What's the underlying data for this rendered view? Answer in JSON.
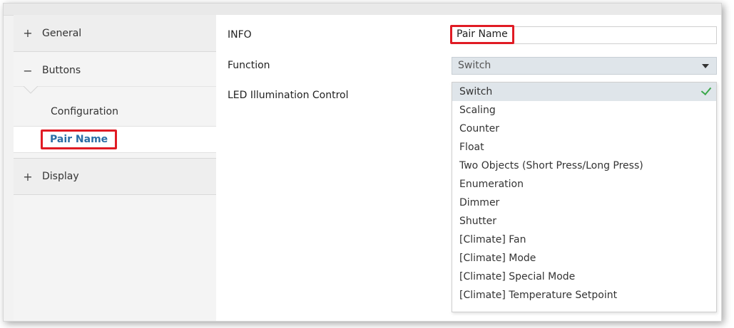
{
  "sidebar": {
    "general": {
      "sign": "+",
      "label": "General"
    },
    "buttons": {
      "sign": "−",
      "label": "Buttons"
    },
    "configuration": {
      "label": "Configuration"
    },
    "pair_name": {
      "label": "Pair Name"
    },
    "display": {
      "sign": "+",
      "label": "Display"
    }
  },
  "params": {
    "info_label": "INFO",
    "info_value": "Pair Name",
    "function_label": "Function",
    "function_value": "Switch",
    "led_label": "LED Illumination Control"
  },
  "dropdown": {
    "options": [
      "Switch",
      "Scaling",
      "Counter",
      "Float",
      "Two Objects (Short Press/Long Press)",
      "Enumeration",
      "Dimmer",
      "Shutter",
      "[Climate] Fan",
      "[Climate] Mode",
      "[Climate] Special Mode",
      "[Climate] Temperature Setpoint"
    ],
    "selected_index": 0
  },
  "colors": {
    "highlight": "#e01b24",
    "selected_link": "#2a6ea6",
    "check": "#3aa84a"
  }
}
